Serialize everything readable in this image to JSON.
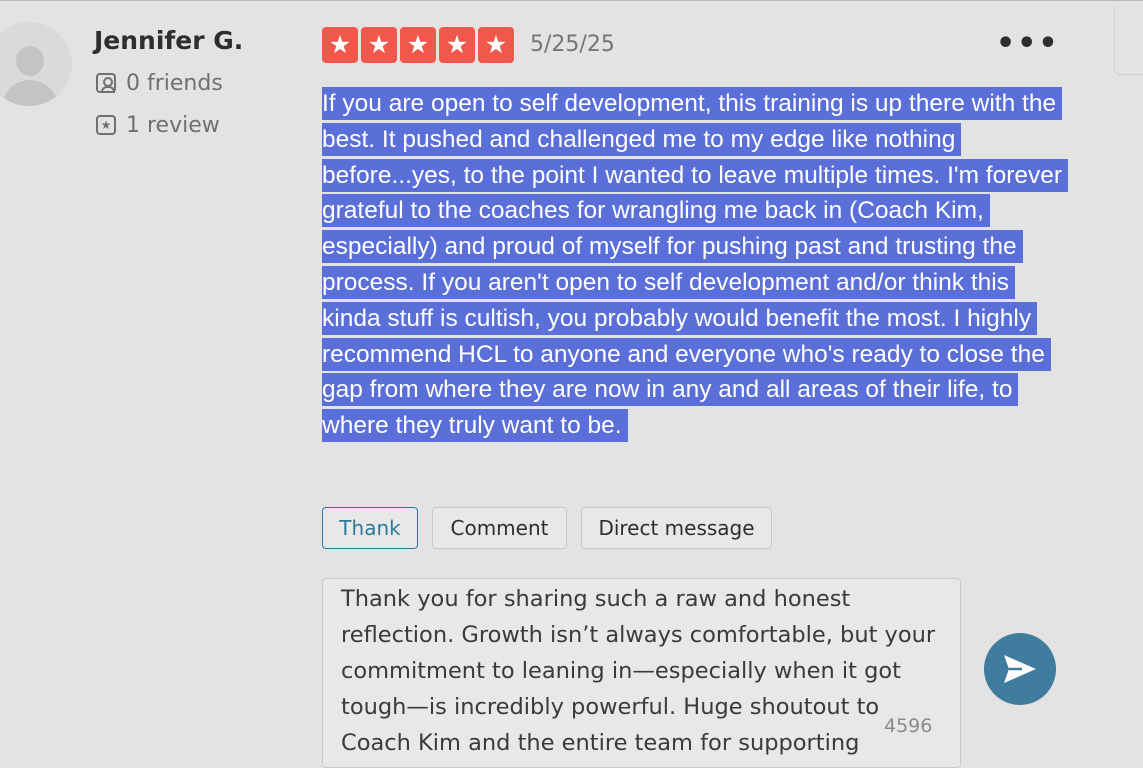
{
  "user": {
    "name": "Jennifer G.",
    "friends": "0 friends",
    "reviews": "1 review"
  },
  "review": {
    "rating": 5,
    "stars": [
      "★",
      "★",
      "★",
      "★",
      "★"
    ],
    "date": "5/25/25",
    "more_menu": "•••",
    "text": "If you are open to self development, this training is up there with the best. It pushed and challenged me to my edge like nothing before...yes, to the point I wanted to leave multiple times. I'm forever grateful to the coaches for wrangling me back in (Coach Kim, especially) and proud of myself for pushing past and trusting the process. If you aren't open to self development and/or think this kinda stuff is cultish, you probably would benefit the most. I highly recommend HCL to anyone and everyone who's ready to close the gap from where they are now in any and all areas of their life, to where they truly want to be."
  },
  "actions": {
    "thank": "Thank",
    "comment": "Comment",
    "direct_message": "Direct message"
  },
  "reply": {
    "text": "Thank you for sharing such a raw and honest reflection. Growth isn’t always comfortable, but your commitment to leaning in—especially when it got tough—is incredibly powerful. Huge shoutout to Coach Kim and the entire team for supporting",
    "char_count": "4596"
  },
  "colors": {
    "star_red": "#f0584b",
    "selection_blue": "#5a6fd8",
    "thank_teal": "#2b7a9b",
    "send_button": "#3f7c9e"
  }
}
